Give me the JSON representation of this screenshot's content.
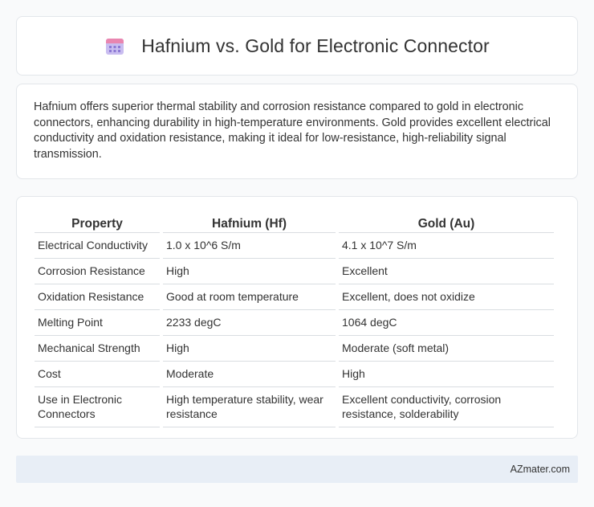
{
  "header": {
    "title": "Hafnium vs. Gold for Electronic Connector",
    "icon": "calendar-icon"
  },
  "description": "Hafnium offers superior thermal stability and corrosion resistance compared to gold in electronic connectors, enhancing durability in high-temperature environments. Gold provides excellent electrical conductivity and oxidation resistance, making it ideal for low-resistance, high-reliability signal transmission.",
  "table": {
    "headers": [
      "Property",
      "Hafnium (Hf)",
      "Gold (Au)"
    ],
    "rows": [
      [
        "Electrical Conductivity",
        "1.0 x 10^6 S/m",
        "4.1 x 10^7 S/m"
      ],
      [
        "Corrosion Resistance",
        "High",
        "Excellent"
      ],
      [
        "Oxidation Resistance",
        "Good at room temperature",
        "Excellent, does not oxidize"
      ],
      [
        "Melting Point",
        "2233 degC",
        "1064 degC"
      ],
      [
        "Mechanical Strength",
        "High",
        "Moderate (soft metal)"
      ],
      [
        "Cost",
        "Moderate",
        "High"
      ],
      [
        "Use in Electronic Connectors",
        "High temperature stability, wear resistance",
        "Excellent conductivity, corrosion resistance, solderability"
      ]
    ]
  },
  "footer": {
    "site": "AZmater.com"
  },
  "colors": {
    "background": "#f9fafb",
    "card": "#ffffff",
    "footer_bg": "#e8eef6",
    "icon_top": "#e57ea8",
    "icon_body": "#b8a6e3"
  }
}
